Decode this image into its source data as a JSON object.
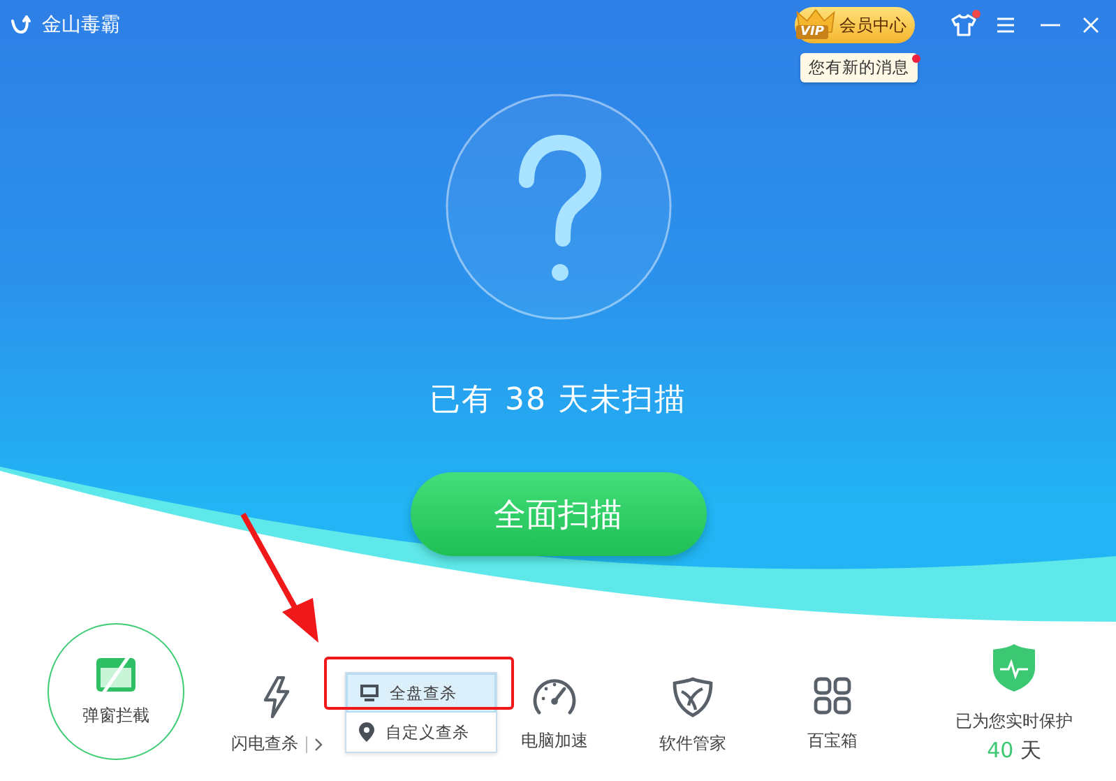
{
  "app": {
    "title": "金山毒霸"
  },
  "vip": {
    "badge": "VIP",
    "label": "会员中心"
  },
  "skin": {
    "badge": true
  },
  "notification": {
    "text": "您有新的消息",
    "unread": true
  },
  "status": "已有 38 天未扫描",
  "scan_button": "全面扫描",
  "popup_block": "弹窗拦截",
  "tools": [
    {
      "kind": "flash",
      "label": "闪电查杀"
    },
    {
      "kind": "speed",
      "label": "电脑加速"
    },
    {
      "kind": "software",
      "label": "软件管家"
    },
    {
      "kind": "toolbox",
      "label": "百宝箱"
    }
  ],
  "dropdown": [
    {
      "kind": "disk",
      "label": "全盘查杀",
      "selected": true
    },
    {
      "kind": "custom",
      "label": "自定义查杀",
      "selected": false
    }
  ],
  "protection": {
    "label": "已为您实时保护",
    "days": "40",
    "unit": "天"
  }
}
